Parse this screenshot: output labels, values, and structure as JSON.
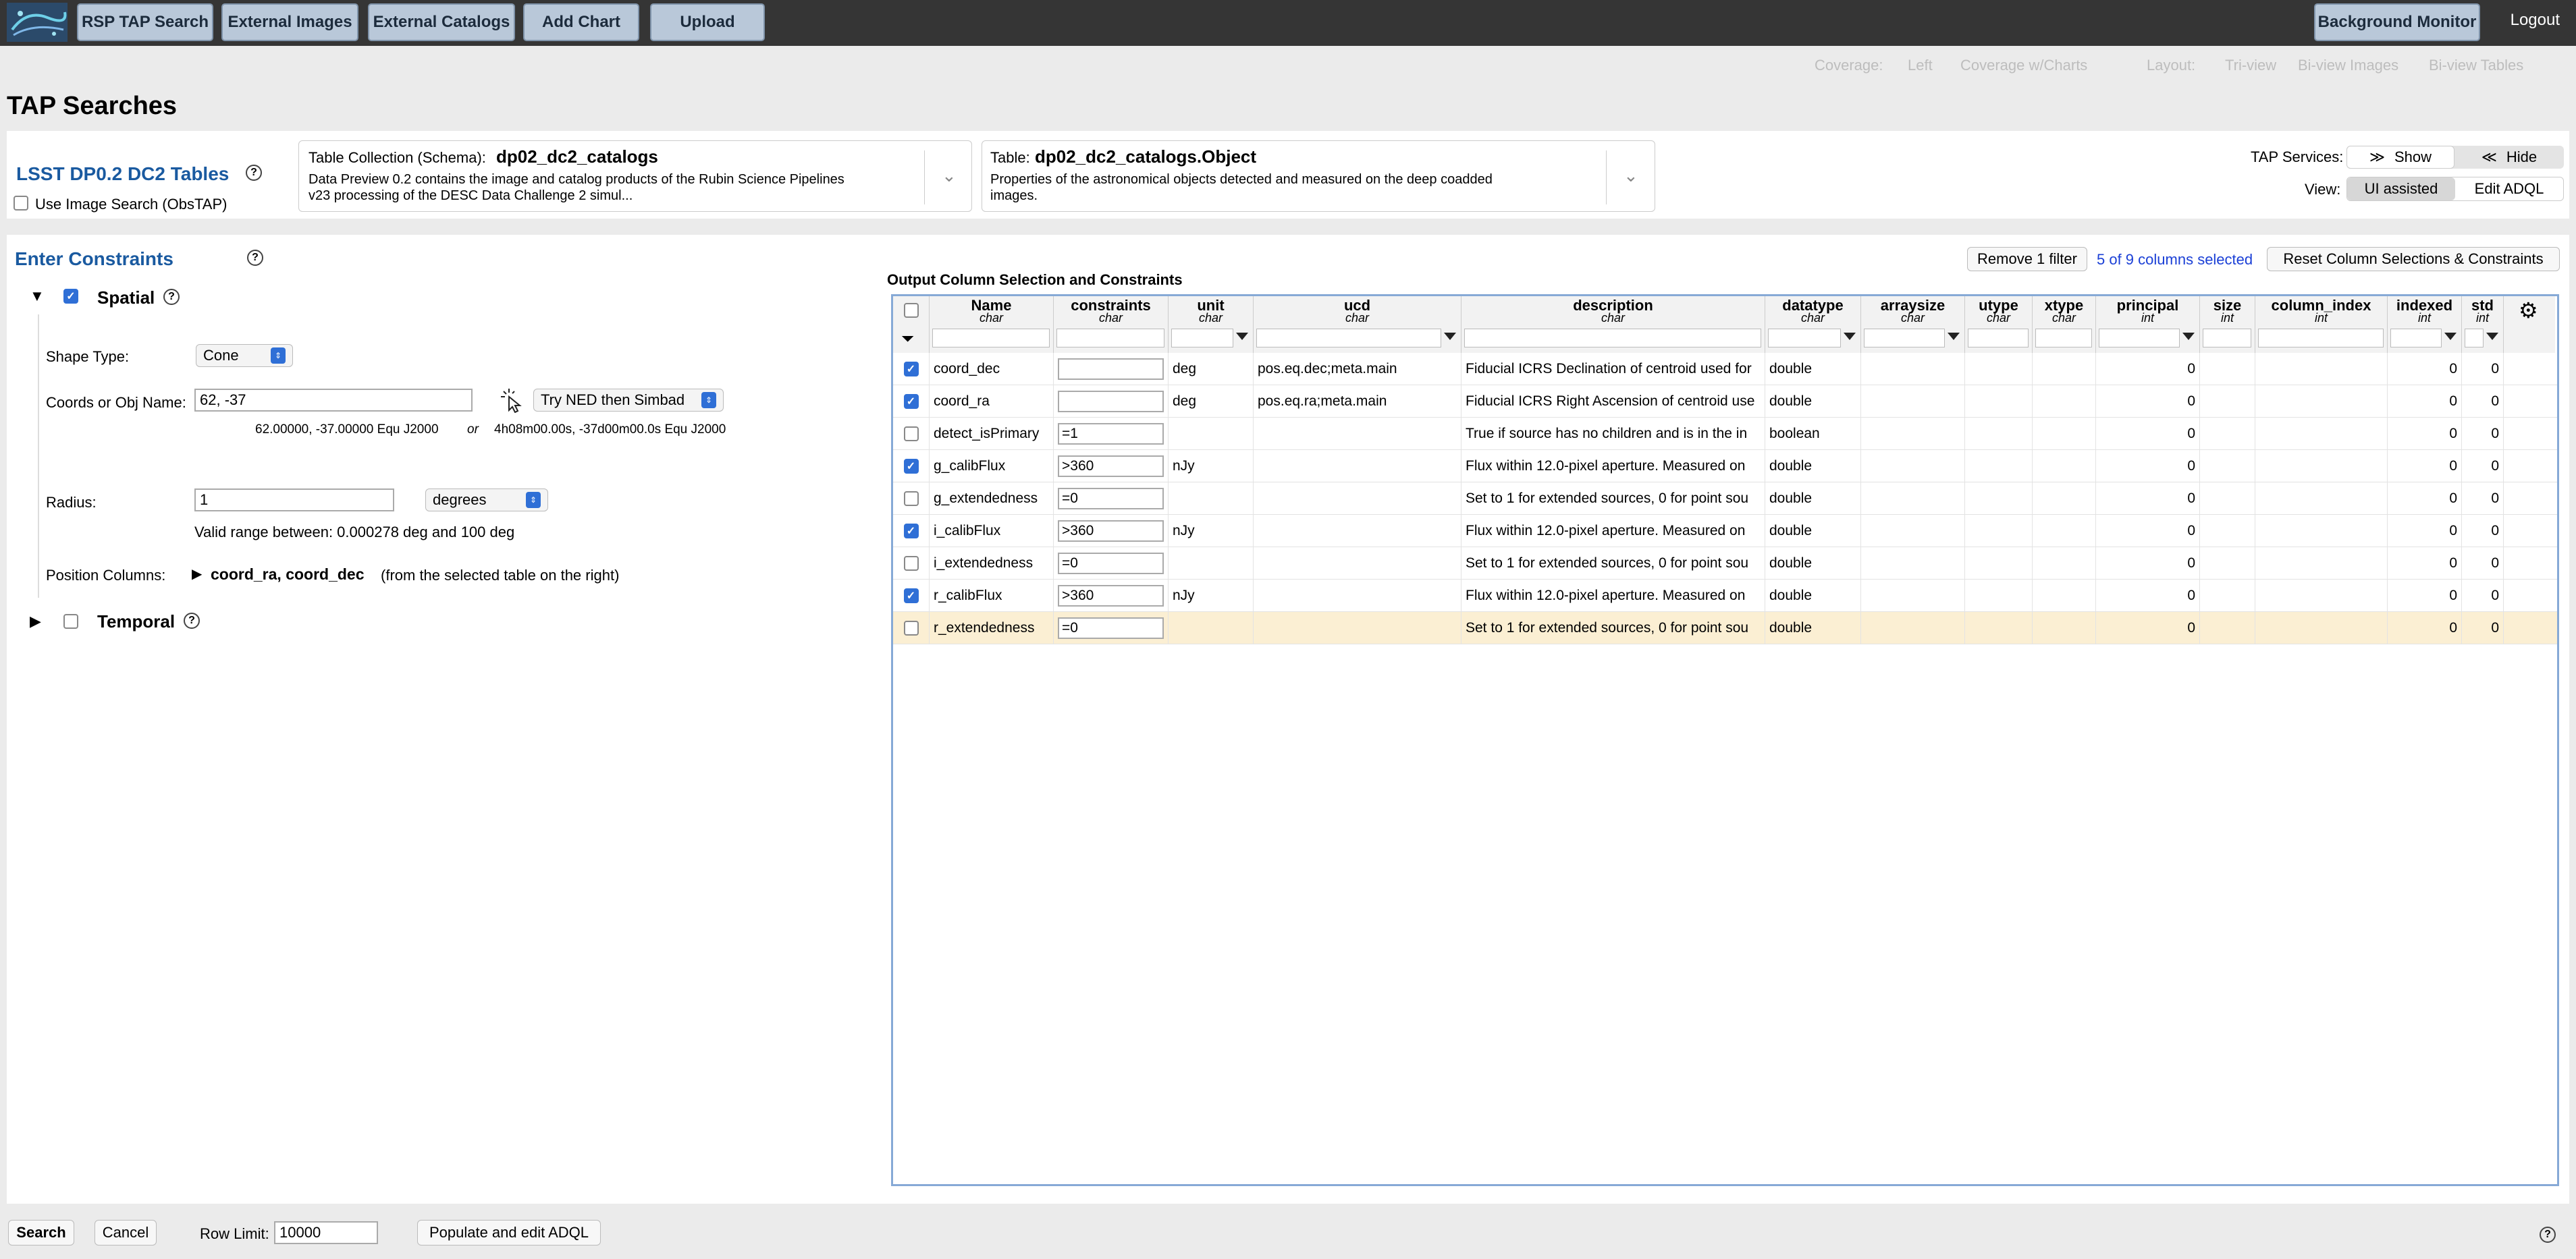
{
  "topbar": {
    "buttons": [
      "RSP TAP Search",
      "External Images",
      "External Catalogs",
      "Add Chart",
      "Upload"
    ],
    "background_monitor": "Background Monitor",
    "logout": "Logout"
  },
  "layoutbar": {
    "coverage_label": "Coverage:",
    "coverage_left": "Left",
    "coverage_charts": "Coverage w/Charts",
    "layout_label": "Layout:",
    "tri_view": "Tri-view",
    "bi_images": "Bi-view Images",
    "bi_tables": "Bi-view Tables"
  },
  "page_title": "TAP Searches",
  "service": {
    "name": "LSST DP0.2 DC2 Tables",
    "use_image_search": "Use Image Search (ObsTAP)",
    "schema_label": "Table Collection (Schema):",
    "schema_value": "dp02_dc2_catalogs",
    "schema_desc_1": "Data Preview 0.2 contains the image and catalog products of the Rubin Science Pipelines",
    "schema_desc_2": "v23 processing of the DESC Data Challenge 2 simul...",
    "table_label": "Table:",
    "table_value": "dp02_dc2_catalogs.Object",
    "table_desc_1": "Properties of the astronomical objects detected and measured on the deep coadded",
    "table_desc_2": "images.",
    "tap_services_label": "TAP Services:",
    "show": "Show",
    "hide": "Hide",
    "view_label": "View:",
    "ui_assisted": "UI assisted",
    "edit_adql": "Edit ADQL"
  },
  "constraints": {
    "title": "Enter Constraints",
    "spatial": "Spatial",
    "shape_type_label": "Shape Type:",
    "shape_type_value": "Cone",
    "coords_label": "Coords or Obj Name:",
    "coords_value": "62, -37",
    "resolver": "Try NED then Simbad",
    "coords_parsed_1": "62.00000, -37.00000  Equ J2000",
    "coords_or": "or",
    "coords_parsed_2": "4h08m00.00s, -37d00m00.0s  Equ J2000",
    "radius_label": "Radius:",
    "radius_value": "1",
    "radius_unit": "degrees",
    "valid_range": "Valid range between: 0.000278 deg and 100 deg",
    "position_columns_label": "Position Columns:",
    "position_columns_value": "coord_ra, coord_dec",
    "position_columns_note": "(from the selected table on the right)",
    "temporal": "Temporal"
  },
  "output": {
    "title": "Output Column Selection and Constraints",
    "remove_filter": "Remove 1 filter",
    "selected_count": "5 of 9 columns selected",
    "reset": "Reset Column Selections & Constraints",
    "columns": [
      {
        "name": "Name",
        "type": "char"
      },
      {
        "name": "constraints",
        "type": "char"
      },
      {
        "name": "unit",
        "type": "char"
      },
      {
        "name": "ucd",
        "type": "char"
      },
      {
        "name": "description",
        "type": "char"
      },
      {
        "name": "datatype",
        "type": "char"
      },
      {
        "name": "arraysize",
        "type": "char"
      },
      {
        "name": "utype",
        "type": "char"
      },
      {
        "name": "xtype",
        "type": "char"
      },
      {
        "name": "principal",
        "type": "int"
      },
      {
        "name": "size",
        "type": "int"
      },
      {
        "name": "column_index",
        "type": "int"
      },
      {
        "name": "indexed",
        "type": "int"
      },
      {
        "name": "std",
        "type": "int"
      }
    ],
    "rows": [
      {
        "checked": true,
        "name": "coord_dec",
        "constraint": "",
        "unit": "deg",
        "ucd": "pos.eq.dec;meta.main",
        "description": "Fiducial ICRS Declination of centroid used for",
        "datatype": "double",
        "principal": "0",
        "indexed": "0",
        "std": "0"
      },
      {
        "checked": true,
        "name": "coord_ra",
        "constraint": "",
        "unit": "deg",
        "ucd": "pos.eq.ra;meta.main",
        "description": "Fiducial ICRS Right Ascension of centroid use",
        "datatype": "double",
        "principal": "0",
        "indexed": "0",
        "std": "0"
      },
      {
        "checked": false,
        "name": "detect_isPrimary",
        "constraint": "=1",
        "unit": "",
        "ucd": "",
        "description": "True if source has no children and is in the in",
        "datatype": "boolean",
        "principal": "0",
        "indexed": "0",
        "std": "0"
      },
      {
        "checked": true,
        "name": "g_calibFlux",
        "constraint": ">360",
        "unit": "nJy",
        "ucd": "",
        "description": "Flux within 12.0-pixel aperture. Measured on",
        "datatype": "double",
        "principal": "0",
        "indexed": "0",
        "std": "0"
      },
      {
        "checked": false,
        "name": "g_extendedness",
        "constraint": "=0",
        "unit": "",
        "ucd": "",
        "description": "Set to 1 for extended sources, 0 for point sou",
        "datatype": "double",
        "principal": "0",
        "indexed": "0",
        "std": "0"
      },
      {
        "checked": true,
        "name": "i_calibFlux",
        "constraint": ">360",
        "unit": "nJy",
        "ucd": "",
        "description": "Flux within 12.0-pixel aperture. Measured on",
        "datatype": "double",
        "principal": "0",
        "indexed": "0",
        "std": "0"
      },
      {
        "checked": false,
        "name": "i_extendedness",
        "constraint": "=0",
        "unit": "",
        "ucd": "",
        "description": "Set to 1 for extended sources, 0 for point sou",
        "datatype": "double",
        "principal": "0",
        "indexed": "0",
        "std": "0"
      },
      {
        "checked": true,
        "name": "r_calibFlux",
        "constraint": ">360",
        "unit": "nJy",
        "ucd": "",
        "description": "Flux within 12.0-pixel aperture. Measured on",
        "datatype": "double",
        "principal": "0",
        "indexed": "0",
        "std": "0"
      },
      {
        "checked": false,
        "name": "r_extendedness",
        "constraint": "=0",
        "unit": "",
        "ucd": "",
        "description": "Set to 1 for extended sources, 0 for point sou",
        "datatype": "double",
        "principal": "0",
        "indexed": "0",
        "std": "0"
      }
    ]
  },
  "footer": {
    "search": "Search",
    "cancel": "Cancel",
    "row_limit_label": "Row Limit:",
    "row_limit_value": "10000",
    "populate": "Populate and edit ADQL"
  },
  "colors": {
    "accent": "#2f6fd6",
    "title_blue": "#1a5aa0",
    "topbar": "#353535",
    "highlight_row": "#fbefd3"
  }
}
